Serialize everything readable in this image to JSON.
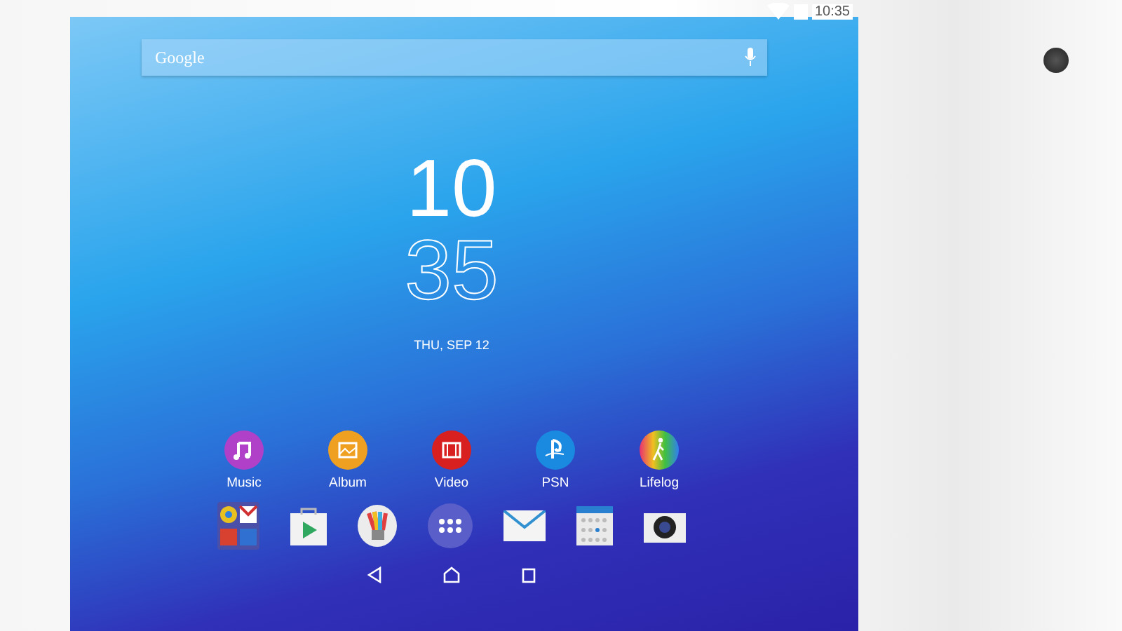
{
  "status_bar": {
    "time": "10:35"
  },
  "search": {
    "placeholder": "Google"
  },
  "clock": {
    "hour": "10",
    "minute": "35",
    "date": "THU, SEP 12"
  },
  "apps": [
    {
      "kind": "music",
      "label": "Music"
    },
    {
      "kind": "album",
      "label": "Album"
    },
    {
      "kind": "video",
      "label": "Video"
    },
    {
      "kind": "psn",
      "label": "PSN"
    },
    {
      "kind": "lifelog",
      "label": "Lifelog"
    }
  ],
  "dock": [
    {
      "kind": "folder"
    },
    {
      "kind": "store"
    },
    {
      "kind": "sketch"
    },
    {
      "kind": "apps"
    },
    {
      "kind": "email"
    },
    {
      "kind": "calendar"
    },
    {
      "kind": "camera"
    }
  ]
}
